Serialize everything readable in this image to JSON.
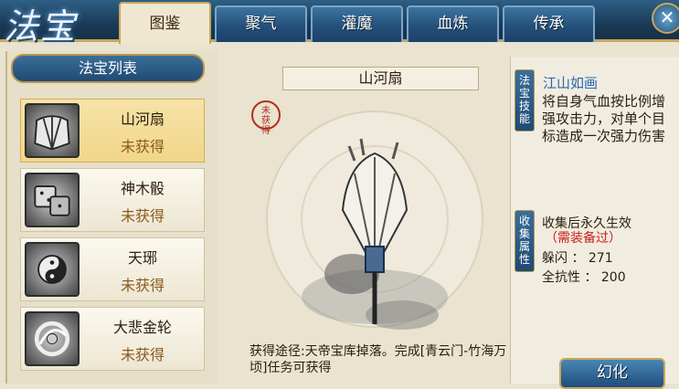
{
  "header": {
    "logo_text": "法宝",
    "tabs": [
      {
        "label": "图鉴",
        "active": true
      },
      {
        "label": "聚气",
        "active": false
      },
      {
        "label": "灌魔",
        "active": false
      },
      {
        "label": "血炼",
        "active": false
      },
      {
        "label": "传承",
        "active": false
      }
    ],
    "close_icon": "close-icon"
  },
  "list": {
    "title": "法宝列表",
    "items": [
      {
        "name": "山河扇",
        "status": "未获得",
        "icon": "fan-icon",
        "selected": true
      },
      {
        "name": "神木骰",
        "status": "未获得",
        "icon": "dice-icon",
        "selected": false
      },
      {
        "name": "天琊",
        "status": "未获得",
        "icon": "taiji-icon",
        "selected": false
      },
      {
        "name": "大悲金轮",
        "status": "未获得",
        "icon": "wheel-icon",
        "selected": false
      }
    ]
  },
  "detail": {
    "name": "山河扇",
    "seal_text": "未获得",
    "obtain_text": "获得途径:天帝宝库掉落。完成[青云门-竹海万顷]任务可获得"
  },
  "skill": {
    "label": "法宝技能",
    "name": "江山如画",
    "desc": "将自身气血按比例增强攻击力，对单个目标造成一次强力伤害"
  },
  "collect": {
    "label": "收集属性",
    "title": "收集后永久生效",
    "note": "（需装备过）",
    "stats": [
      "躲闪 ： 271",
      "全抗性 ： 200"
    ]
  },
  "actions": {
    "transform_label": "幻化"
  },
  "colors": {
    "accent_blue": "#24507a",
    "gold_border": "#c9a65a",
    "selected_bg": "#f1d68a",
    "status_brown": "#8a5a1e",
    "note_red": "#c8201c"
  }
}
